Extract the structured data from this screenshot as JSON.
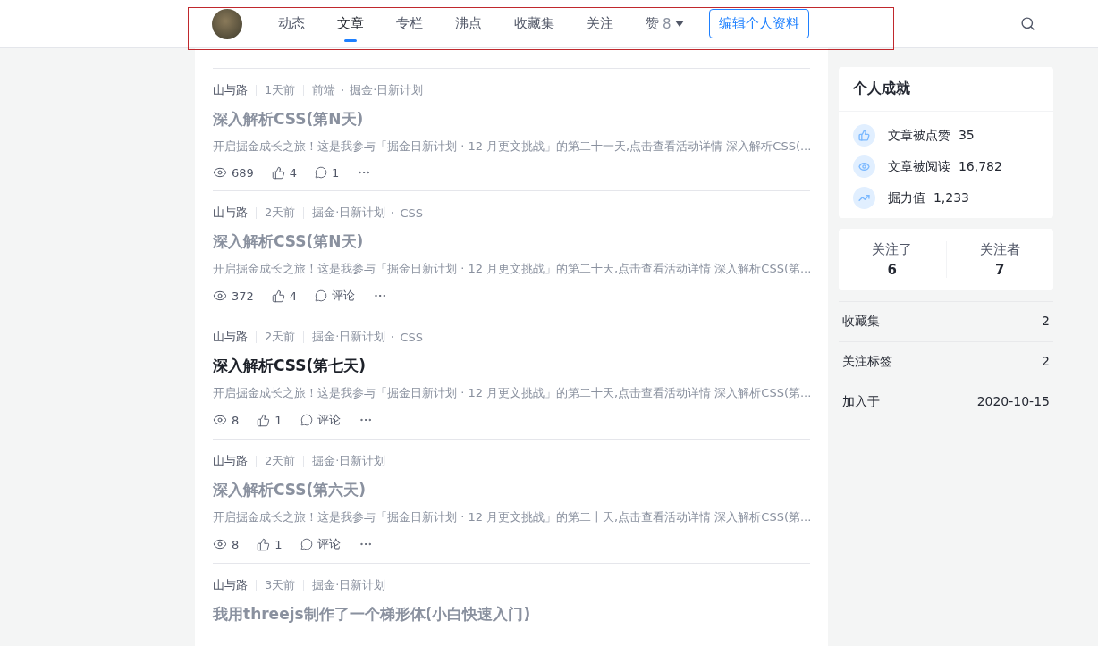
{
  "nav": {
    "tabs": [
      {
        "label": "动态",
        "selected": false
      },
      {
        "label": "文章",
        "selected": true
      },
      {
        "label": "专栏",
        "selected": false
      },
      {
        "label": "沸点",
        "selected": false
      },
      {
        "label": "收藏集",
        "selected": false
      },
      {
        "label": "关注",
        "selected": false
      }
    ],
    "likes": {
      "label": "赞",
      "count": "8"
    },
    "edit_button": "编辑个人资料"
  },
  "articles": [
    {
      "author": "山与路",
      "time": "1天前",
      "tags": [
        "前端",
        "掘金·日新计划"
      ],
      "title": "深入解析CSS(第N天)",
      "visited": true,
      "excerpt": "开启掘金成长之旅！这是我参与「掘金日新计划 · 12 月更文挑战」的第二十一天,点击查看活动详情 深入解析CSS(...",
      "views": "689",
      "likes": "4",
      "comments": "1"
    },
    {
      "author": "山与路",
      "time": "2天前",
      "tags": [
        "掘金·日新计划",
        "CSS"
      ],
      "title": "深入解析CSS(第N天)",
      "visited": true,
      "excerpt": "开启掘金成长之旅！这是我参与「掘金日新计划 · 12 月更文挑战」的第二十天,点击查看活动详情 深入解析CSS(第...",
      "views": "372",
      "likes": "4",
      "comments": "评论"
    },
    {
      "author": "山与路",
      "time": "2天前",
      "tags": [
        "掘金·日新计划",
        "CSS"
      ],
      "title": "深入解析CSS(第七天)",
      "visited": false,
      "excerpt": "开启掘金成长之旅！这是我参与「掘金日新计划 · 12 月更文挑战」的第二十天,点击查看活动详情 深入解析CSS(第...",
      "views": "8",
      "likes": "1",
      "comments": "评论"
    },
    {
      "author": "山与路",
      "time": "2天前",
      "tags": [
        "掘金·日新计划"
      ],
      "title": "深入解析CSS(第六天)",
      "visited": true,
      "excerpt": "开启掘金成长之旅！这是我参与「掘金日新计划 · 12 月更文挑战」的第二十天,点击查看活动详情 深入解析CSS(第...",
      "views": "8",
      "likes": "1",
      "comments": "评论"
    },
    {
      "author": "山与路",
      "time": "3天前",
      "tags": [
        "掘金·日新计划"
      ],
      "title": "我用threejs制作了一个梯形体(小白快速入门)",
      "visited": true
    }
  ],
  "achievements": {
    "title": "个人成就",
    "items": [
      {
        "kind": "likes",
        "label": "文章被点赞",
        "value": "35"
      },
      {
        "kind": "views",
        "label": "文章被阅读",
        "value": "16,782"
      },
      {
        "kind": "power",
        "label": "掘力值",
        "value": "1,233"
      }
    ]
  },
  "follow": [
    {
      "label": "关注了",
      "count": "6"
    },
    {
      "label": "关注者",
      "count": "7"
    }
  ],
  "stats": [
    {
      "label": "收藏集",
      "value": "2"
    },
    {
      "label": "关注标签",
      "value": "2"
    },
    {
      "label": "加入于",
      "value": "2020-10-15"
    }
  ]
}
